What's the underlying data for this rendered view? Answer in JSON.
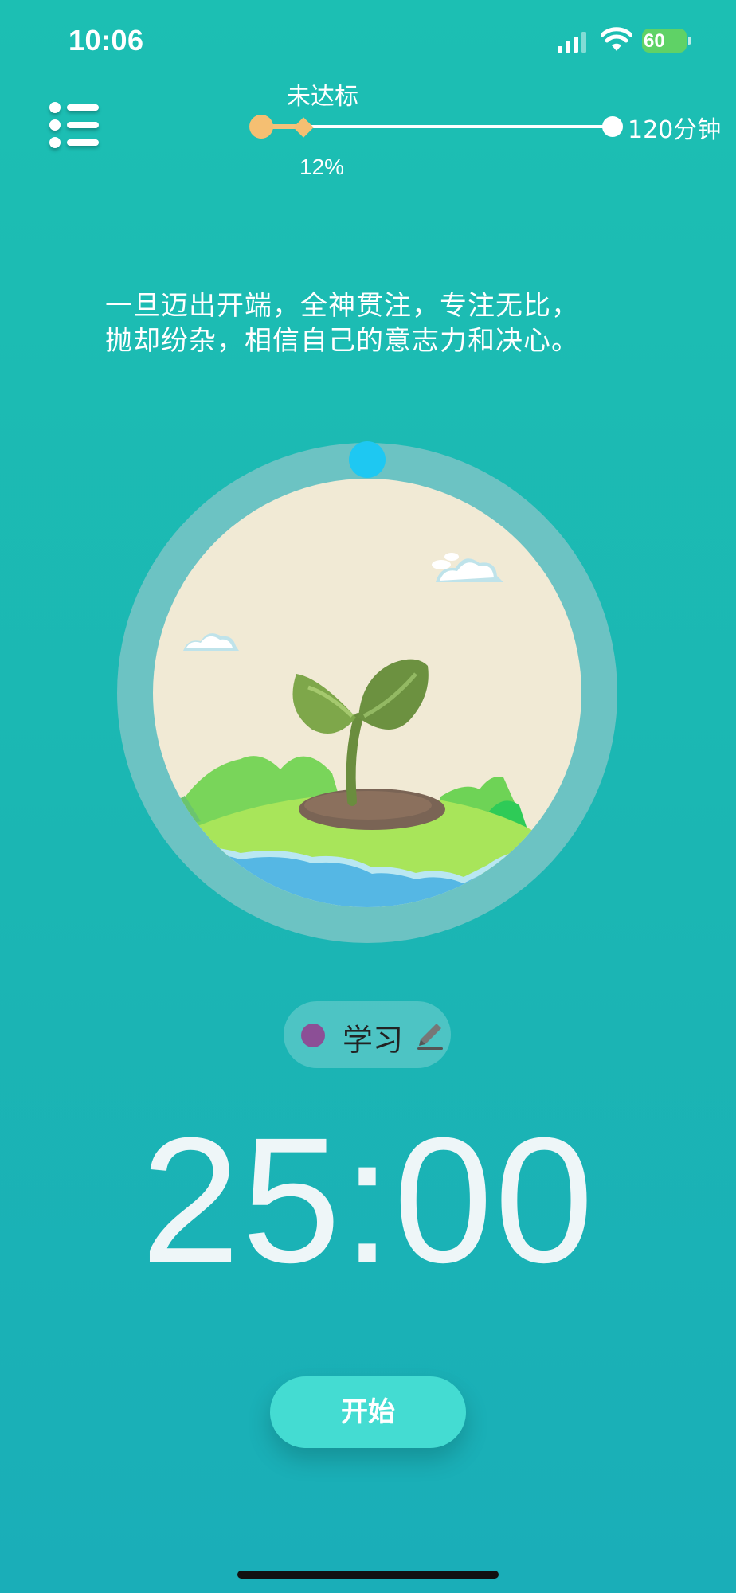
{
  "status_bar": {
    "time": "10:06",
    "battery_percent": "60",
    "icons": [
      "signal-icon",
      "wifi-icon",
      "battery-charging-icon"
    ]
  },
  "menu": {
    "icon": "list-icon"
  },
  "goal": {
    "status": "未达标",
    "max_label": "120分钟",
    "progress_label": "12%",
    "progress_fraction": 0.12,
    "colors": {
      "fill": "#f5bf72",
      "track": "#ffffff"
    }
  },
  "quote": {
    "line1": "一旦迈出开端，全神贯注，专注无比，",
    "line2": "抛却纷杂，相信自己的意志力和决心。"
  },
  "timer": {
    "illustration": "sprout-plant-illustration",
    "knob_color": "#1ec8f2",
    "ring_color": "#6cc3c3"
  },
  "tag": {
    "label": "学习",
    "color": "#8c4f96",
    "edit_icon": "pencil-icon"
  },
  "countdown": "25:00",
  "start_button": {
    "label": "开始",
    "color": "#44dcd2"
  }
}
